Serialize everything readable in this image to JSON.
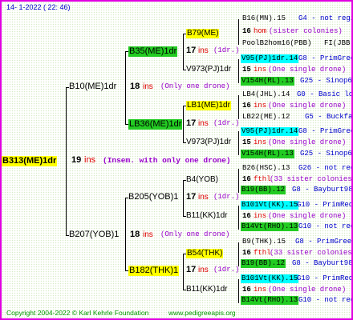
{
  "header": "14-  1-2022 ( 22: 46)",
  "footer": {
    "copyright": "Copyright 2004-2022 © Karl Kehrle Foundation",
    "url": "www.pedigreeapis.org"
  },
  "colors": {
    "frame": "#e000e0",
    "yellow": "#ffff00",
    "green": "#22cc22",
    "cyan": "#00ffff",
    "red": "#e00000",
    "blue": "#0000cc",
    "purple": "#9900cc"
  },
  "root": {
    "name": "B313(ME)1dr",
    "ins_num": "19",
    "ins_word": "ins",
    "note": "(Insem. with only one drone)"
  },
  "gen1": [
    {
      "name": "B10(ME)1dr",
      "ins_num": "18",
      "ins_word": "ins",
      "note": "(Only one drone)"
    },
    {
      "name": "B207(YOB)1",
      "ins_num": "18",
      "ins_word": "ins",
      "note": "(Only one drone)"
    }
  ],
  "gen2": [
    {
      "name": "B35(ME)1dr",
      "ins_num": "17",
      "ins_word": "ins",
      "note": "(1dr.)"
    },
    {
      "name": "LB36(ME)1dr",
      "ins_num": "17",
      "ins_word": "ins",
      "note": "(1dr.)"
    },
    {
      "name": "B205(YOB)1",
      "ins_num": "17",
      "ins_word": "ins",
      "note": "(1dr.)"
    },
    {
      "name": "B182(THK)1",
      "ins_num": "17",
      "ins_word": "ins",
      "note": "(1dr.)"
    }
  ],
  "gen3": [
    {
      "name": "B79(ME)"
    },
    {
      "name": "V973(PJ)1dr"
    },
    {
      "name": "LB1(ME)1dr"
    },
    {
      "name": "V973(PJ)1dr"
    },
    {
      "name": "B4(YOB)"
    },
    {
      "name": "B11(KK)1dr"
    },
    {
      "name": "B54(THK)"
    },
    {
      "name": "B11(KK)1dr"
    }
  ],
  "gen4": [
    {
      "name": "B16(MN).15",
      "info": "G4 - not registe"
    },
    {
      "num": "16",
      "word": "hom",
      "rest": "(sister colonies)"
    },
    {
      "name": "PoolB2hom16(PBB)",
      "info": "PoolB2hom16(PJB)",
      "extra": "FI(JBB"
    },
    {
      "name": "V95(PJ)1dr.14",
      "info": "G8 - PrimGreen00"
    },
    {
      "num": "15",
      "word": "ins",
      "rest": "(One single drone)"
    },
    {
      "name": "V154H(RL).13",
      "info": "G25 - Sinop62R"
    },
    {
      "name": "LB4(JHL).14",
      "info": "G0 - Basic local"
    },
    {
      "num": "16",
      "word": "ins",
      "rest": "(One single drone)"
    },
    {
      "name": "LB22(ME).12",
      "info": "G5 - Buckfast"
    },
    {
      "name": "V95(PJ)1dr.14",
      "info": "G8 - PrimGreen00"
    },
    {
      "num": "15",
      "word": "ins",
      "rest": "(One single drone)"
    },
    {
      "name": "V154H(RL).13",
      "info": "G25 - Sinop62R"
    },
    {
      "name": "B26(HSC).13",
      "info": "G26 - not registe"
    },
    {
      "num": "16",
      "word": "fthl",
      "rest": "(33 sister colonies)"
    },
    {
      "name": "B19(BB).12",
      "info": "G8 - Bayburt98-3"
    },
    {
      "name": "B101Vt(KK).15",
      "info": "G10 - PrimRed01"
    },
    {
      "num": "16",
      "word": "ins",
      "rest": "(One single drone)"
    },
    {
      "name": "B14Vt(RHO).13",
      "info": "G10 - not registe"
    },
    {
      "name": "B9(THK).15",
      "info": "G8 - PrimGreen00"
    },
    {
      "num": "16",
      "word": "fthl",
      "rest": "(33 sister colonies)"
    },
    {
      "name": "B19(BB).12",
      "info": "G8 - Bayburt98-3"
    },
    {
      "name": "B101Vt(KK).15",
      "info": "G10 - PrimRed01"
    },
    {
      "num": "16",
      "word": "ins",
      "rest": "(One single drone)"
    },
    {
      "name": "B14Vt(RHO).13",
      "info": "G10 - not registe"
    }
  ]
}
